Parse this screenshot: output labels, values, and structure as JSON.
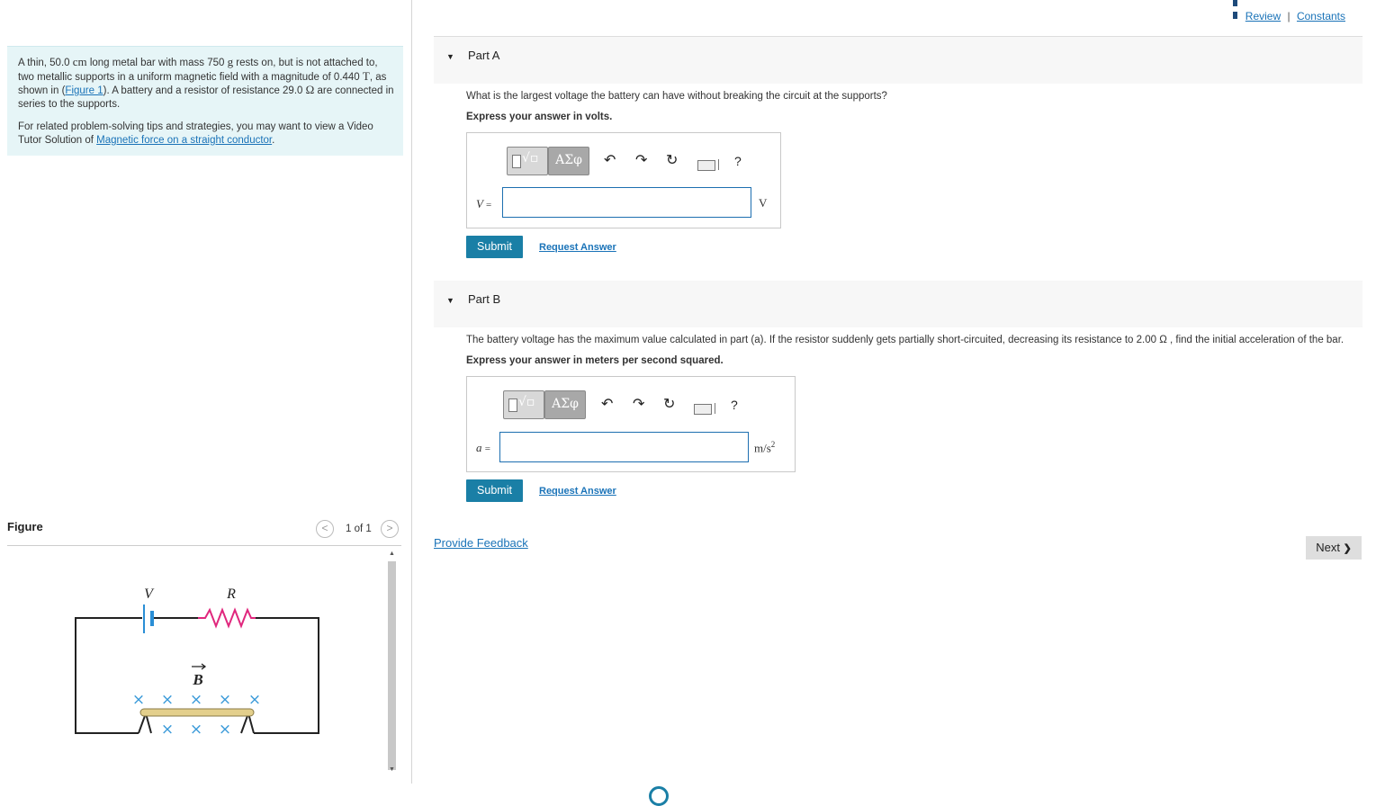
{
  "header": {
    "review_label": "Review",
    "separator": "|",
    "constants_label": "Constants"
  },
  "problem": {
    "text1_a": "A thin, 50.0 ",
    "unit_cm": "cm",
    "text1_b": " long metal bar with mass 750 ",
    "unit_g": "g",
    "text1_c": " rests on, but is not attached to, two metallic supports in a uniform magnetic field with a magnitude of 0.440 ",
    "unit_T": "T",
    "text1_d": ", as shown in (",
    "figure_link": "Figure 1",
    "text1_e": "). A battery and a resistor of resistance 29.0 ",
    "unit_ohm": "Ω",
    "text1_f": " are connected in series to the supports.",
    "text2": "For related problem-solving tips and strategies, you may want to view a Video Tutor Solution of ",
    "tutor_link": "Magnetic force on a straight conductor",
    "text2_end": "."
  },
  "figure": {
    "title": "Figure",
    "prev": "<",
    "next": ">",
    "pager": "1 of 1",
    "label_V": "V",
    "label_R": "R",
    "label_B": "B",
    "field_symbol": "×"
  },
  "toolbar": {
    "greek": "ΑΣφ",
    "undo": "↶",
    "redo": "↷",
    "reset": "↻",
    "help": "?"
  },
  "part_a": {
    "title": "Part A",
    "question": "What is the largest voltage the battery can have without breaking the circuit at the supports?",
    "instruction": "Express your answer in volts.",
    "variable": "V",
    "equals": "=",
    "input_value": "",
    "unit": "V",
    "submit": "Submit",
    "request": "Request Answer"
  },
  "part_b": {
    "title": "Part B",
    "question": "The battery voltage has the maximum value calculated in part (a). If the resistor suddenly gets partially short-circuited, decreasing its resistance to 2.00 Ω , find the initial acceleration of the bar.",
    "instruction": "Express your answer in meters per second squared.",
    "variable": "a",
    "equals": "=",
    "input_value": "",
    "unit": "m/s",
    "unit_exp": "2",
    "submit": "Submit",
    "request": "Request Answer"
  },
  "footer": {
    "feedback": "Provide Feedback",
    "next": "Next",
    "next_icon": "❯"
  },
  "colors": {
    "accent": "#1a7fa6",
    "link": "#1a73b8",
    "problem_bg": "#e6f5f7",
    "resistor": "#e0277d",
    "battery": "#2a8fd6",
    "field_x": "#3a9ad9",
    "bar": "#e3cf8c"
  }
}
